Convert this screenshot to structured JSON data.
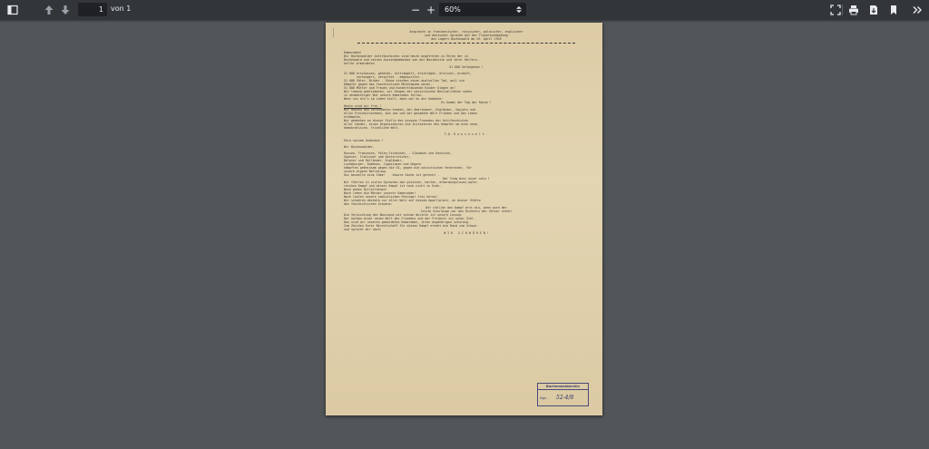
{
  "toolbar": {
    "page_current": "1",
    "page_total": "von 1",
    "zoom_value": "60%",
    "zoom_out": "−",
    "zoom_in": "+"
  },
  "icons": {
    "sidebar": "sidebar-toggle-icon",
    "prev": "arrow-up-icon",
    "next": "arrow-down-icon",
    "fit": "fit-page-icon",
    "print": "print-icon",
    "download": "download-icon",
    "bookmark": "bookmark-icon",
    "more": "more-icon"
  },
  "document": {
    "header_lines": [
      "Ansprache in franzoesischer, russischer, polnischer, englischer",
      "und deutscher Sprache auf der Trauerkundgebung",
      "des Lagers Buchenwald am 19. April 1945"
    ],
    "body": [
      {
        "t": "Kameraden!",
        "cls": ""
      },
      {
        "t": "Wir Buchenwalder Antifaschisten sind heute angetreten zu Ehren der in",
        "cls": ""
      },
      {
        "t": "Buchenwald und seinen Aussenkommandos von der Nazibestie und ihrer Helfers-",
        "cls": ""
      },
      {
        "t": "helfer ermordeten",
        "cls": ""
      },
      {
        "t": "51 000 Gefangenen !",
        "cls": "center"
      },
      {
        "t": "",
        "cls": "gap"
      },
      {
        "t": "51 000 erschossen, gehenkt, zertrampelt, erschlagen, erstickt, ersäuft,",
        "cls": ""
      },
      {
        "t": "       verhungert, vergiftet - abgespritzt -",
        "cls": ""
      },
      {
        "t": "51 000 Väter, Brüder - Söhne starben einen qualvollen Tod, weil sie",
        "cls": ""
      },
      {
        "t": "Kämpfer gegen das faschistische Mordregime waren.",
        "cls": ""
      },
      {
        "t": "51 000 Mütter und Frauen und hunderttausende Kinder klagen an!",
        "cls": ""
      },
      {
        "t": "Wir lebend gebliebenen, wir Zeugen der nazistischen Bestialitäten sahen",
        "cls": ""
      },
      {
        "t": "in ohnmächtiger Wut unsere Kameraden fallen.",
        "cls": ""
      },
      {
        "t": "Wenn uns ein's im Leben hielt, dann war es der Gedanke:",
        "cls": ""
      },
      {
        "t": "Es kommt der Tag der Rache !",
        "cls": "center"
      },
      {
        "t": "Heute sind wir frei !",
        "cls": "ul"
      },
      {
        "t": "Wir danken den verbündeten Armeen, der Amerikaner, Engländer, Sowjets und",
        "cls": ""
      },
      {
        "t": "allen Freiheitsarmeen, die uns und der gesamten Welt Frieden und das Leben",
        "cls": ""
      },
      {
        "t": "erkämpfen.",
        "cls": ""
      },
      {
        "t": "Wir gedenken an dieser Stelle des grossen Freundes der Antifaschisten",
        "cls": ""
      },
      {
        "t": "aller Länder, eines Organisatoren und Initiatoren des Kampfes um eine neue,",
        "cls": ""
      },
      {
        "t": "demokratische, friedliche Welt.",
        "cls": ""
      },
      {
        "t": "",
        "cls": "gap"
      },
      {
        "t": "F.D. R o o s e v e l t .",
        "cls": "center"
      },
      {
        "t": "",
        "cls": "gap"
      },
      {
        "t": "Ehre seinem Andenken !",
        "cls": ""
      },
      {
        "t": "",
        "cls": "gap"
      },
      {
        "t": "Wir Buchenwalder,",
        "cls": ""
      },
      {
        "t": "",
        "cls": "gap"
      },
      {
        "t": "Russen, Franzosen, Polen,Tschechen, - Slowaken und Deutsche,",
        "cls": ""
      },
      {
        "t": "Spanier, Italiener und Oesterreicher,",
        "cls": ""
      },
      {
        "t": "Belgier und Holländer, Engländer,",
        "cls": ""
      },
      {
        "t": "Luxemburger, Rumänen, Jugoslaven und Ungarn",
        "cls": ""
      },
      {
        "t": "kämpften gemeinsam gegen die SS, gegen die nazistischen Verbrecher, für",
        "cls": ""
      },
      {
        "t": "unsere eigene Befreiung.",
        "cls": ""
      },
      {
        "t": "Uns beseelte eine Idee:    Unsere Sache ist gerecht -",
        "cls": ""
      },
      {
        "t": "Der Sieg muss unser sein !",
        "cls": "center"
      },
      {
        "t": "Wir führten in vielen Sprachen den gleichen, harten, erbarmungslosen,opfer-",
        "cls": ""
      },
      {
        "t": "reichen Kampf und dieser Kampf ist noch nicht zu Ende.",
        "cls": ""
      },
      {
        "t": "Noch wehen Hitlerfahnen!",
        "cls": ""
      },
      {
        "t": "Noch leben die Mörder unserer Kameraden!",
        "cls": ""
      },
      {
        "t": "Noch laufen unsere sadistischen Peiniger frei herum!",
        "cls": ""
      },
      {
        "t": "Wir schwören deshalb vor aller Welt auf diesem Appellplatz, an dieser Stätte",
        "cls": ""
      },
      {
        "t": "des faschistischen Grauens:",
        "cls": ""
      },
      {
        "t": "Wir stellen den Kampf erst ein, wenn auch der",
        "cls": "center"
      },
      {
        "t": "letzte Schuldige vor den Richtern der Völker steht!",
        "cls": "center"
      },
      {
        "t": "Die Vernichtung des Nazismus mit seinen Wurzeln ist unsere Losung.",
        "cls": ""
      },
      {
        "t": "Der Aufbau einer neuen Welt des Friedens und der Freiheit ist unser Ziel.",
        "cls": ""
      },
      {
        "t": "Das sind wir unseren gemordeten Kameraden, ihren Angehörigen schuldig.",
        "cls": ""
      },
      {
        "t": "Zum Zeichen Eurer Bereitschaft für diesen Kampf erhebt die Hand zum Schwur",
        "cls": ""
      },
      {
        "t": "und sprecht mir nach:",
        "cls": ""
      },
      {
        "t": "W I R   S C H W Ö R E N !",
        "cls": "center"
      }
    ],
    "stamp": {
      "title": "Buchenwaldarchiv",
      "sig_label": "Sign.",
      "sig_value": "52-4/8"
    }
  }
}
